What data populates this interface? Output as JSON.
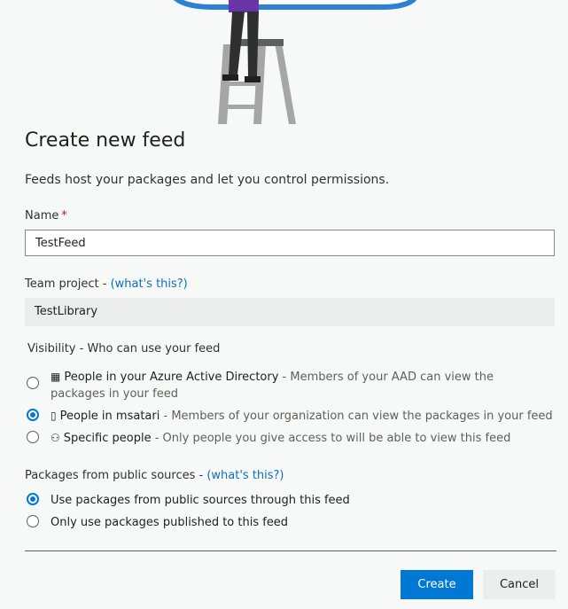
{
  "dialog": {
    "title": "Create new feed",
    "description": "Feeds host your packages and let you control permissions."
  },
  "name_field": {
    "label": "Name",
    "required_mark": "*",
    "value": "TestFeed"
  },
  "team_project": {
    "label": "Team project - ",
    "help_link": "(what's this?)",
    "value": "TestLibrary"
  },
  "visibility": {
    "heading": "Visibility - Who can use your feed",
    "options": [
      {
        "icon": "directory-icon",
        "title": "People in your Azure Active Directory",
        "separator": " - ",
        "description": "Members of your AAD can view the packages in your feed",
        "selected": false
      },
      {
        "icon": "organization-icon",
        "title": "People in msatari",
        "separator": " - ",
        "description": "Members of your organization can view the packages in your feed",
        "selected": true
      },
      {
        "icon": "people-icon",
        "title": "Specific people",
        "separator": " - ",
        "description": "Only people you give access to will be able to view this feed",
        "selected": false
      }
    ]
  },
  "upstream": {
    "heading": "Packages from public sources - ",
    "help_link": "(what's this?)",
    "options": [
      {
        "label": "Use packages from public sources through this feed",
        "selected": true
      },
      {
        "label": "Only use packages published to this feed",
        "selected": false
      }
    ]
  },
  "buttons": {
    "create_label": "Create",
    "cancel_label": "Cancel"
  },
  "colors": {
    "accent": "#0078d4",
    "link": "#106ebe",
    "background": "#f7f9f8",
    "cloud": "#2f7fd6",
    "figure_shirt": "#6a35a8"
  }
}
